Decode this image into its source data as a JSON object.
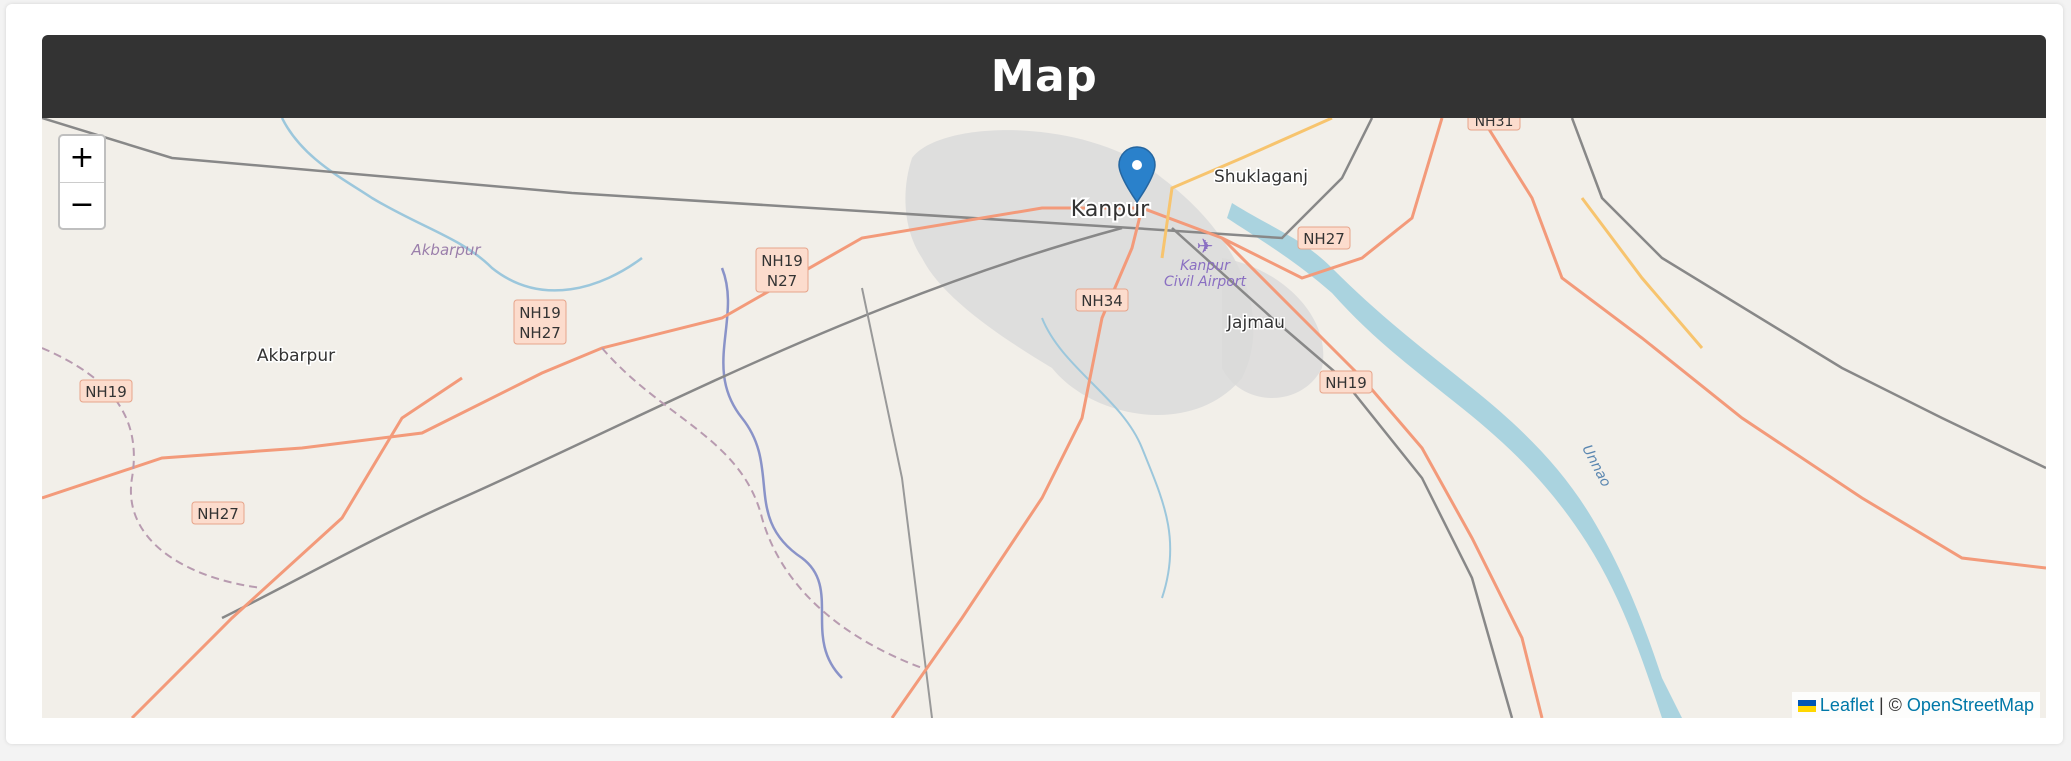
{
  "header": {
    "title": "Map"
  },
  "zoom": {
    "in_label": "+",
    "out_label": "−"
  },
  "places": {
    "kanpur": "Kanpur",
    "shuklaganj": "Shuklaganj",
    "jajmau": "Jajmau",
    "akbarpur_town": "Akbarpur",
    "akbarpur_district": "Akbarpur",
    "airport_line1": "Kanpur",
    "airport_line2": "Civil Airport",
    "river": "Unnao"
  },
  "road_shields": {
    "nh19_n27_line1": "NH19",
    "nh19_n27_line2": "N27",
    "nh19_nh27_line1": "NH19",
    "nh19_nh27_line2": "NH27",
    "nh19_west": "NH19",
    "nh27_southwest": "NH27",
    "nh34": "NH34",
    "nh27_east": "NH27",
    "nh19_east": "NH19",
    "nh31": "NH31"
  },
  "attribution": {
    "leaflet": "Leaflet",
    "separator": " | © ",
    "osm": "OpenStreetMap"
  },
  "colors": {
    "header_bg": "#333333",
    "map_bg": "#f2efe9",
    "marker": "#2a81cb",
    "road_primary": "#f39a7a",
    "water": "#aad3df"
  }
}
